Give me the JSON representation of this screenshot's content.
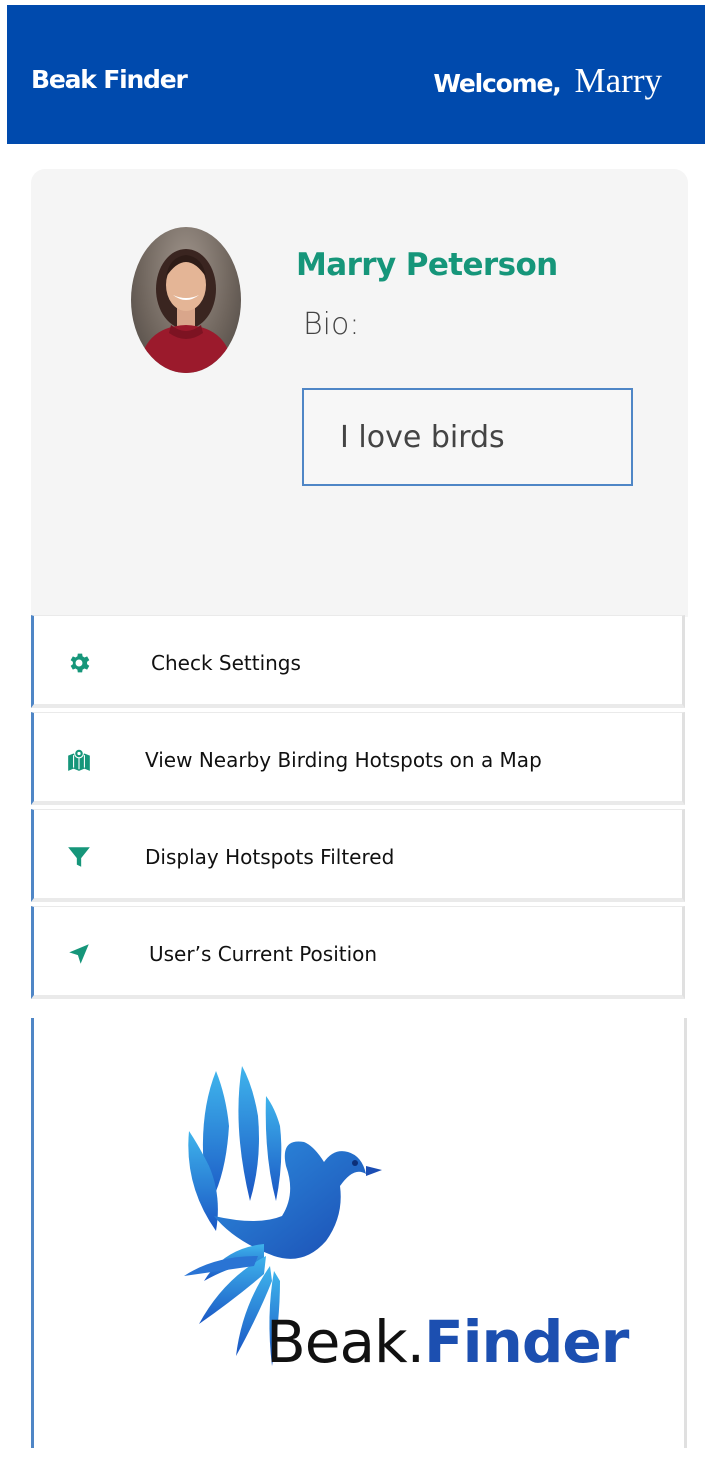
{
  "header": {
    "brand": "Beak Finder",
    "welcome_label": "Welcome,",
    "user_first_name": "Marry",
    "background": "#004aad"
  },
  "profile": {
    "name": "Marry Peterson",
    "bio_label": "Bio:",
    "bio_value": "I love birds",
    "name_color": "#16967a"
  },
  "menu": {
    "icon_color": "#16967a",
    "items": [
      {
        "label": "Check Settings",
        "icon": "gear-icon"
      },
      {
        "label": "View Nearby Birding Hotspots on a Map",
        "icon": "map-icon"
      },
      {
        "label": "Display Hotspots Filtered",
        "icon": "filter-icon"
      },
      {
        "label": "User’s Current Position",
        "icon": "location-arrow-icon"
      }
    ]
  },
  "logo": {
    "text_part1": "Beak.",
    "text_part2": "Finder",
    "accent": "#1c4fb0"
  }
}
